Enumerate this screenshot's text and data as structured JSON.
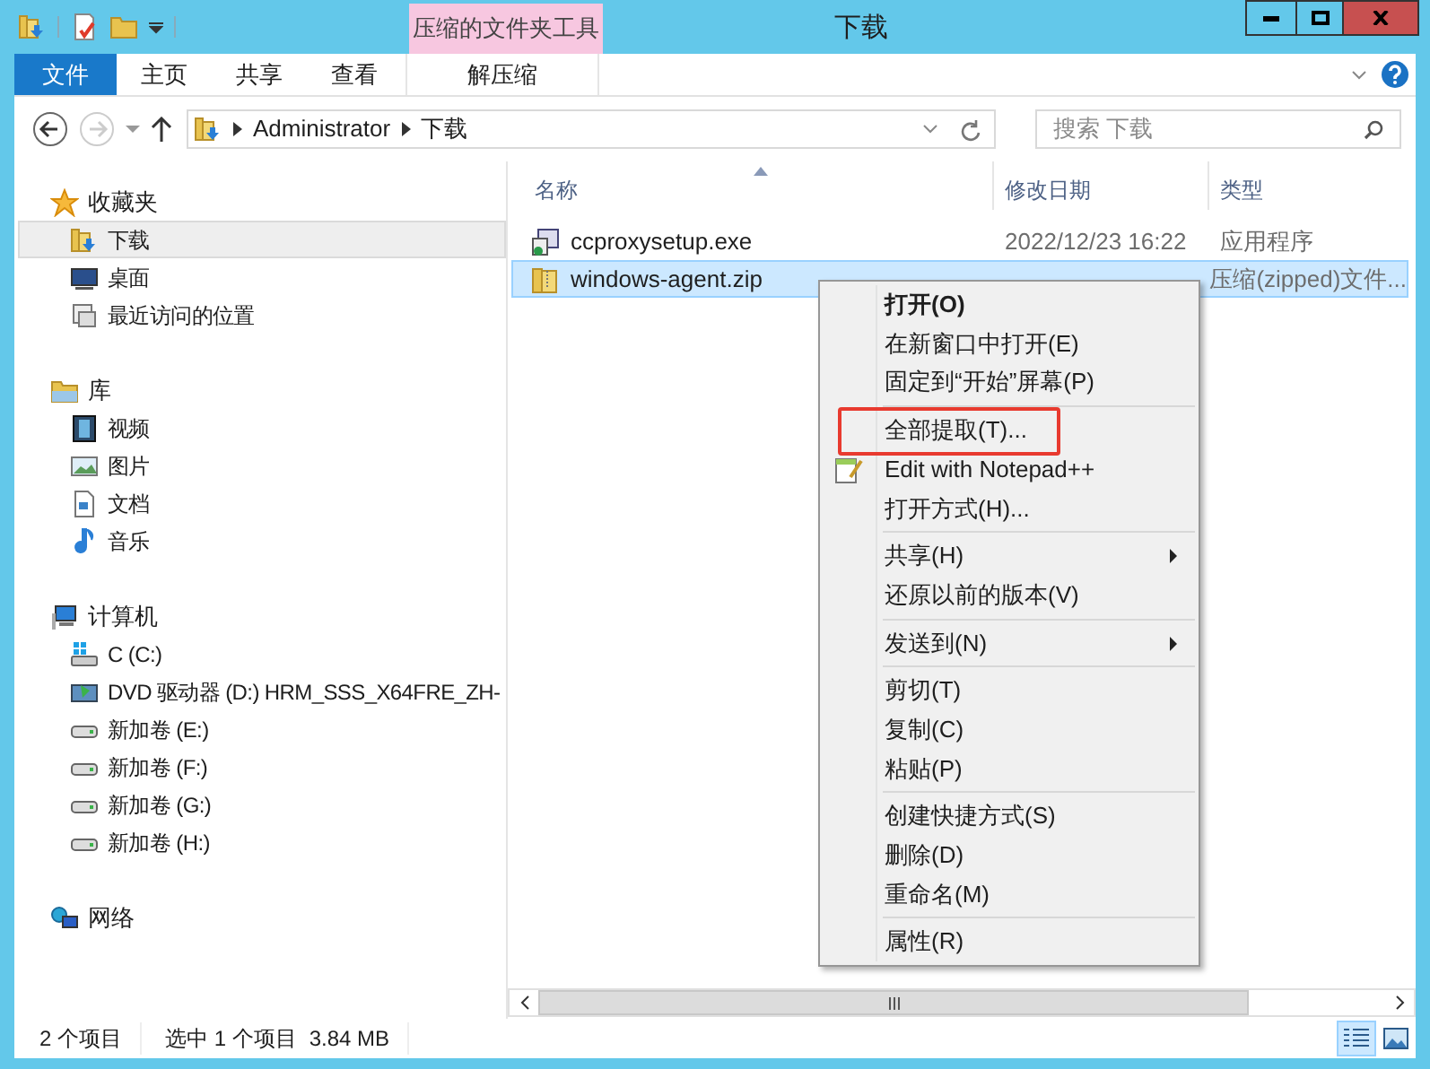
{
  "window": {
    "title": "下载",
    "context_tab": "压缩的文件夹工具"
  },
  "ribbon_tabs": [
    {
      "label": "文件",
      "selected": false,
      "kind": "file"
    },
    {
      "label": "主页",
      "selected": false,
      "kind": "tab"
    },
    {
      "label": "共享",
      "selected": false,
      "kind": "tab"
    },
    {
      "label": "查看",
      "selected": false,
      "kind": "tab"
    },
    {
      "label": "解压缩",
      "selected": false,
      "kind": "context"
    }
  ],
  "address": {
    "path": [
      "Administrator",
      "下载"
    ]
  },
  "search": {
    "placeholder": "搜索 下载"
  },
  "sidebar": {
    "groups": [
      {
        "label": "收藏夹",
        "children": [
          {
            "label": "下载",
            "selected": true
          },
          {
            "label": "桌面",
            "selected": false
          },
          {
            "label": "最近访问的位置",
            "selected": false
          }
        ]
      },
      {
        "label": "库",
        "children": [
          {
            "label": "视频",
            "selected": false
          },
          {
            "label": "图片",
            "selected": false
          },
          {
            "label": "文档",
            "selected": false
          },
          {
            "label": "音乐",
            "selected": false
          }
        ]
      },
      {
        "label": "计算机",
        "children": [
          {
            "label": "C (C:)",
            "selected": false
          },
          {
            "label": "DVD 驱动器 (D:) HRM_SSS_X64FRE_ZH-",
            "selected": false
          },
          {
            "label": "新加卷 (E:)",
            "selected": false
          },
          {
            "label": "新加卷 (F:)",
            "selected": false
          },
          {
            "label": "新加卷 (G:)",
            "selected": false
          },
          {
            "label": "新加卷 (H:)",
            "selected": false
          }
        ]
      },
      {
        "label": "网络"
      }
    ]
  },
  "table": {
    "columns": [
      "名称",
      "修改日期",
      "类型"
    ],
    "rows": [
      {
        "name": "ccproxysetup.exe",
        "date": "2022/12/23 16:22",
        "type": "应用程序",
        "selected": false
      },
      {
        "name": "windows-agent.zip",
        "type": "压缩(zipped)文件...",
        "selected": true
      }
    ]
  },
  "context_menu": [
    {
      "kind": "item",
      "label": "打开(O)",
      "bold": true,
      "submenu": false,
      "highlighted": false
    },
    {
      "kind": "item",
      "label": "在新窗口中打开(E)",
      "bold": false,
      "submenu": false,
      "highlighted": false
    },
    {
      "kind": "item",
      "label": "固定到“开始”屏幕(P)",
      "bold": false,
      "submenu": false,
      "highlighted": false
    },
    {
      "kind": "separator"
    },
    {
      "kind": "item",
      "label": "全部提取(T)...",
      "bold": false,
      "submenu": false,
      "highlighted": true
    },
    {
      "kind": "icon_item",
      "label": "Edit with Notepad++",
      "bold": false,
      "submenu": false,
      "highlighted": false
    },
    {
      "kind": "item",
      "label": "打开方式(H)...",
      "bold": false,
      "submenu": false,
      "highlighted": false
    },
    {
      "kind": "separator"
    },
    {
      "kind": "item",
      "label": "共享(H)",
      "bold": false,
      "submenu": true,
      "highlighted": false
    },
    {
      "kind": "item",
      "label": "还原以前的版本(V)",
      "bold": false,
      "submenu": false,
      "highlighted": false
    },
    {
      "kind": "separator"
    },
    {
      "kind": "item",
      "label": "发送到(N)",
      "bold": false,
      "submenu": true,
      "highlighted": false
    },
    {
      "kind": "separator"
    },
    {
      "kind": "item",
      "label": "剪切(T)",
      "bold": false,
      "submenu": false,
      "highlighted": false
    },
    {
      "kind": "item",
      "label": "复制(C)",
      "bold": false,
      "submenu": false,
      "highlighted": false
    },
    {
      "kind": "item",
      "label": "粘贴(P)",
      "bold": false,
      "submenu": false,
      "highlighted": false
    },
    {
      "kind": "separator"
    },
    {
      "kind": "item",
      "label": "创建快捷方式(S)",
      "bold": false,
      "submenu": false,
      "highlighted": false
    },
    {
      "kind": "item",
      "label": "删除(D)",
      "bold": false,
      "submenu": false,
      "highlighted": false
    },
    {
      "kind": "item",
      "label": "重命名(M)",
      "bold": false,
      "submenu": false,
      "highlighted": false
    },
    {
      "kind": "separator"
    },
    {
      "kind": "item",
      "label": "属性(R)",
      "bold": false,
      "submenu": false,
      "highlighted": false
    }
  ],
  "status_bar": {
    "count": "2 个项目",
    "selection": "选中 1 个项目",
    "size": "3.84 MB"
  }
}
